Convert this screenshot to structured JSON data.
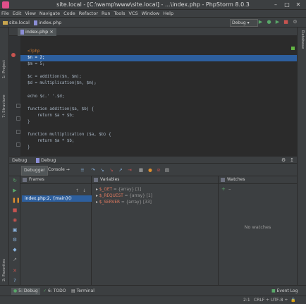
{
  "window": {
    "title": "site.local - [C:\\wamp\\www\\site.local] - ...\\index.php - PhpStorm 8.0.3"
  },
  "menu": [
    "File",
    "Edit",
    "View",
    "Navigate",
    "Code",
    "Refactor",
    "Run",
    "Tools",
    "VCS",
    "Window",
    "Help"
  ],
  "breadcrumbs": {
    "project": "site.local",
    "file": "index.php"
  },
  "toolbar": {
    "run_config": "Debug"
  },
  "side_tools": {
    "project": "1: Project",
    "structure": "7: Structure",
    "favorites": "2: Favorites",
    "database": "Database"
  },
  "editor": {
    "tab": "index.php",
    "lines": [
      "<?php",
      "$n = 2;",
      "$m = 5;",
      "",
      "$c = addition($n, $m);",
      "$d = multiplication($n, $m);",
      "",
      "echo $c.' '.$d;",
      "",
      "function addition($a, $b) {",
      "    return $a + $b;",
      "}",
      "",
      "function multiplication ($a, $b) {",
      "    return $a * $b;",
      "}"
    ]
  },
  "debug": {
    "header": "Debug",
    "config": "Debug",
    "tabs": {
      "debugger": "Debugger",
      "console": "Console"
    },
    "frames": {
      "title": "Frames",
      "items": [
        "index.php:2, {main}()"
      ]
    },
    "variables": {
      "title": "Variables",
      "items": [
        {
          "name": "$_GET",
          "meta": "= {array} [1]"
        },
        {
          "name": "$_REQUEST",
          "meta": "= {array} [1]"
        },
        {
          "name": "$_SERVER",
          "meta": "= {array} [33]"
        }
      ]
    },
    "watches": {
      "title": "Watches",
      "empty": "No watches"
    }
  },
  "bottom_tabs": {
    "debug": "5: Debug",
    "todo": "6: TODO",
    "terminal": "Terminal",
    "event_log": "Event Log"
  },
  "status": {
    "position": "2:1",
    "line_sep": "CRLF ÷",
    "encoding": "UTF-8 ÷"
  }
}
